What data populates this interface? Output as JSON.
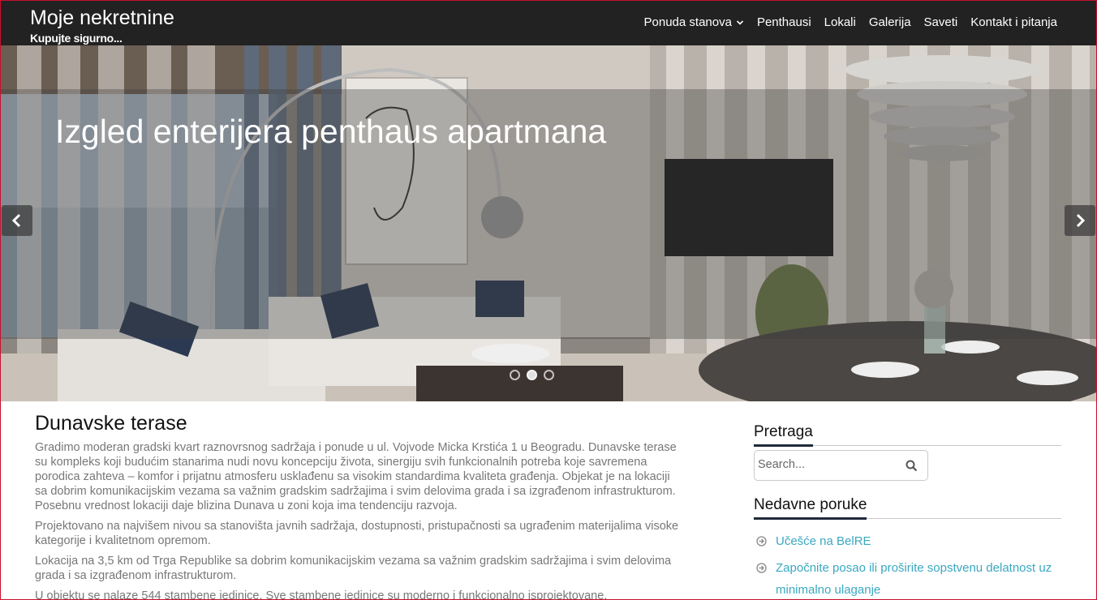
{
  "header": {
    "site_title": "Moje nekretnine",
    "tagline": "Kupujte sigurno...",
    "nav": [
      {
        "label": "Ponuda stanova",
        "has_dropdown": true
      },
      {
        "label": "Penthausi"
      },
      {
        "label": "Lokali"
      },
      {
        "label": "Galerija"
      },
      {
        "label": "Saveti"
      },
      {
        "label": "Kontakt i pitanja"
      }
    ]
  },
  "hero": {
    "caption": "Izgled enterijera penthaus apartmana",
    "prev_icon": "chevron-left-icon",
    "next_icon": "chevron-right-icon",
    "slide_count": 3,
    "active_slide": 2
  },
  "article": {
    "title": "Dunavske terase",
    "paragraphs": [
      "Gradimo moderan gradski kvart raznovrsnog sadržaja i ponude u ul. Vojvode Micka Krstića 1 u Beogradu. Dunavske terase su kompleks koji budućim stanarima nudi novu koncepciju života, sinergiju svih funkcionalnih potreba koje savremena porodica zahteva – komfor i prijatnu atmosferu usklađenu sa visokim standardima kvaliteta građenja. Objekat je na lokaciji sa dobrim komunikacijskim vezama sa važnim gradskim sadržajima i svim delovima grada i sa izgrađenom infrastrukturom. Posebnu vrednost lokaciji daje blizina Dunava u zoni koja ima tendenciju razvoja.",
      "Projektovano na najvišem nivou sa stanovišta javnih sadržaja, dostupnosti, pristupačnosti sa ugrađenim materijalima visoke kategorije i kvalitetnom opremom.",
      "Lokacija na 3,5 km od Trga Republike sa dobrim komunikacijskim vezama sa važnim gradskim sadržajima i svim delovima grada i sa izgrađenom infrastrukturom.",
      "U objektu se nalaze 544 stambene jedinice. Sve stambene jedinice su moderno i funkcionalno isprojektovane."
    ]
  },
  "sidebar": {
    "search_title": "Pretraga",
    "search_placeholder": "Search...",
    "recent_title": "Nedavne poruke",
    "recent_posts": [
      "Učešće na BelRE",
      "Započnite posao ili proširite sopstvenu delatnost uz minimalno ulaganje"
    ]
  },
  "colors": {
    "topbar": "#222222",
    "link": "#3aa8c1",
    "body_text": "#777777",
    "widget_underline": "#1f2a3a"
  }
}
